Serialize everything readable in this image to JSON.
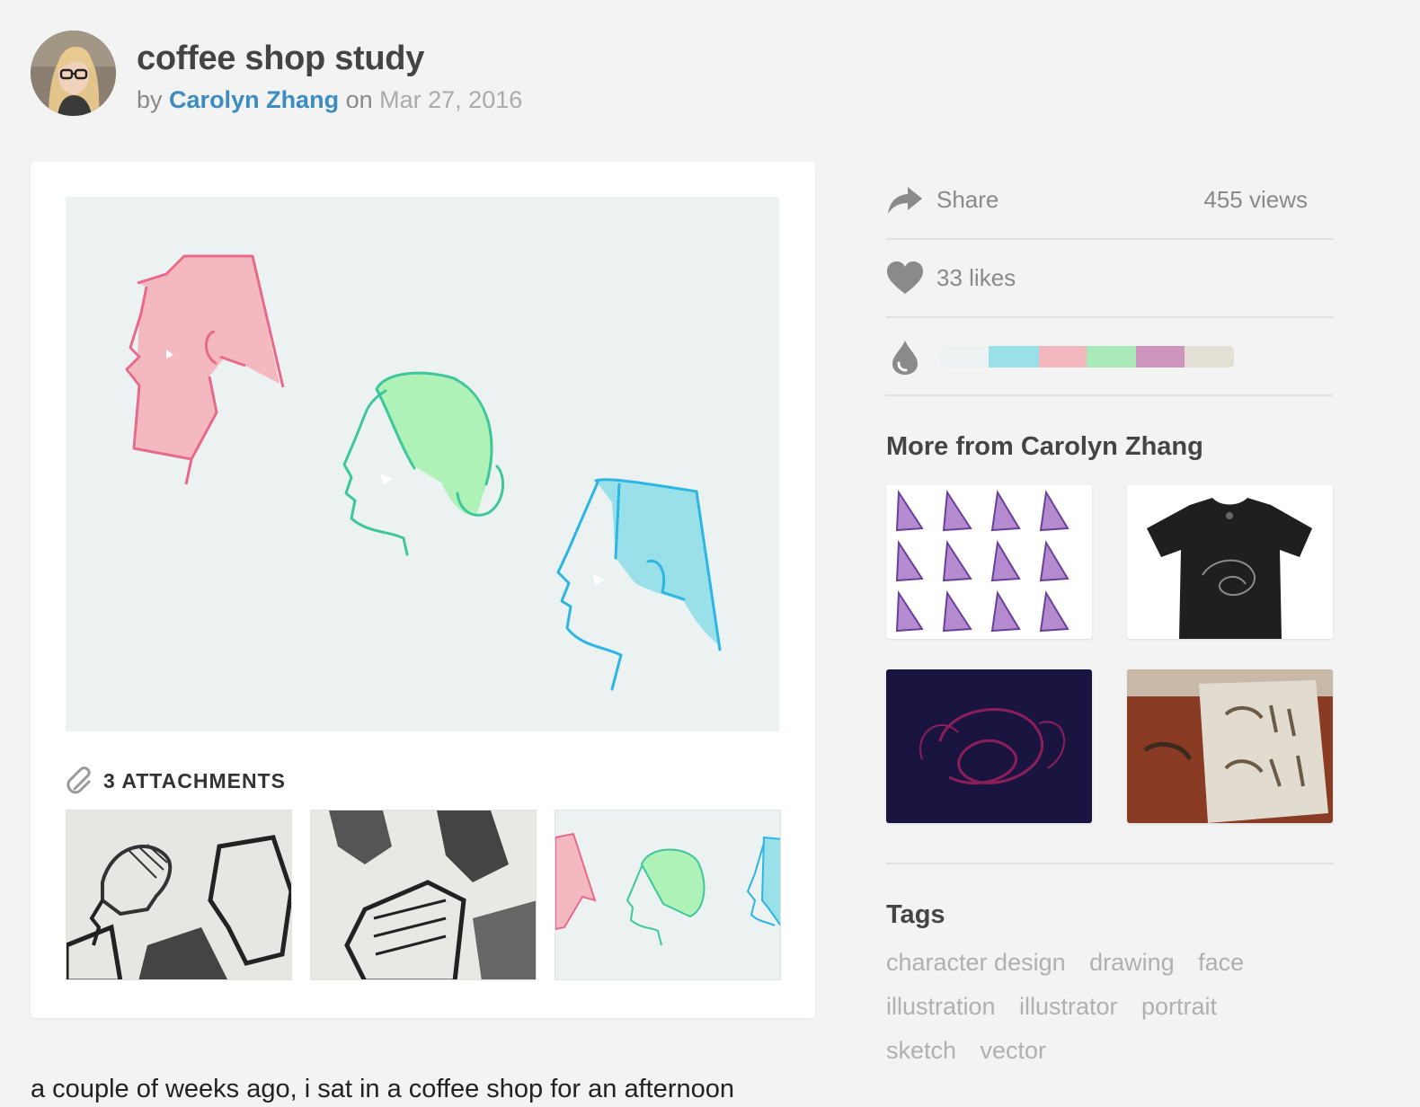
{
  "project": {
    "title": "coffee shop study",
    "by_label": "by",
    "author": "Carolyn Zhang",
    "on_label": "on",
    "date": "Mar 27, 2016"
  },
  "attachments": {
    "label": "3 ATTACHMENTS"
  },
  "stats": {
    "share_label": "Share",
    "views": "455 views",
    "likes": "33 likes"
  },
  "palette": [
    "#ecf1f1",
    "#9be0e8",
    "#f2b8bd",
    "#a9eab8",
    "#cd94be",
    "#e4dfd4"
  ],
  "more": {
    "heading": "More from Carolyn Zhang"
  },
  "tags": {
    "heading": "Tags",
    "items": [
      "character design",
      "drawing",
      "face",
      "illustration",
      "illustrator",
      "portrait",
      "sketch",
      "vector"
    ]
  },
  "description": "a couple of weeks ago, i sat in a coffee shop for an afternoon"
}
